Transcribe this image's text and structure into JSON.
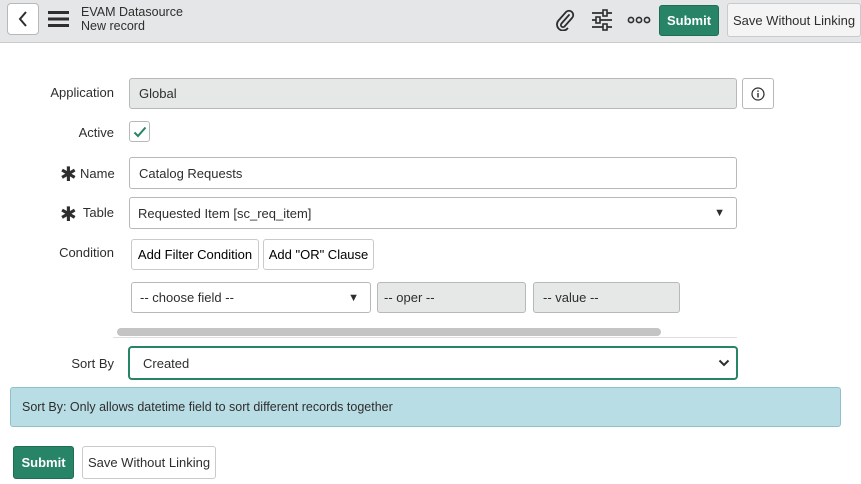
{
  "header": {
    "title": "EVAM Datasource",
    "subtitle": "New record",
    "submit_label": "Submit",
    "save_without_linking_label": "Save Without Linking",
    "icons": [
      "back-icon",
      "hamburger-menu-icon",
      "paperclip-icon",
      "sliders-icon",
      "more-options-icon"
    ]
  },
  "form": {
    "application": {
      "label": "Application",
      "value": "Global"
    },
    "active": {
      "label": "Active",
      "checked": true
    },
    "name": {
      "label": "Name",
      "value": "Catalog Requests",
      "required": true
    },
    "table": {
      "label": "Table",
      "value": "Requested Item [sc_req_item]",
      "required": true
    },
    "condition": {
      "label": "Condition",
      "add_filter_label": "Add Filter Condition",
      "add_or_label": "Add \"OR\" Clause",
      "field_placeholder": "-- choose field --",
      "oper_placeholder": "-- oper --",
      "value_placeholder": "-- value --"
    },
    "sort_by": {
      "label": "Sort By",
      "value": "Created"
    }
  },
  "info_message": "Sort By: Only allows datetime field to sort different records together",
  "footer": {
    "submit_label": "Submit",
    "save_without_linking_label": "Save Without Linking"
  },
  "colors": {
    "primary": "#278467",
    "header_bg": "#e4e6e7",
    "info_bg": "#b9dde4",
    "readonly_bg": "#e6e8e8"
  }
}
